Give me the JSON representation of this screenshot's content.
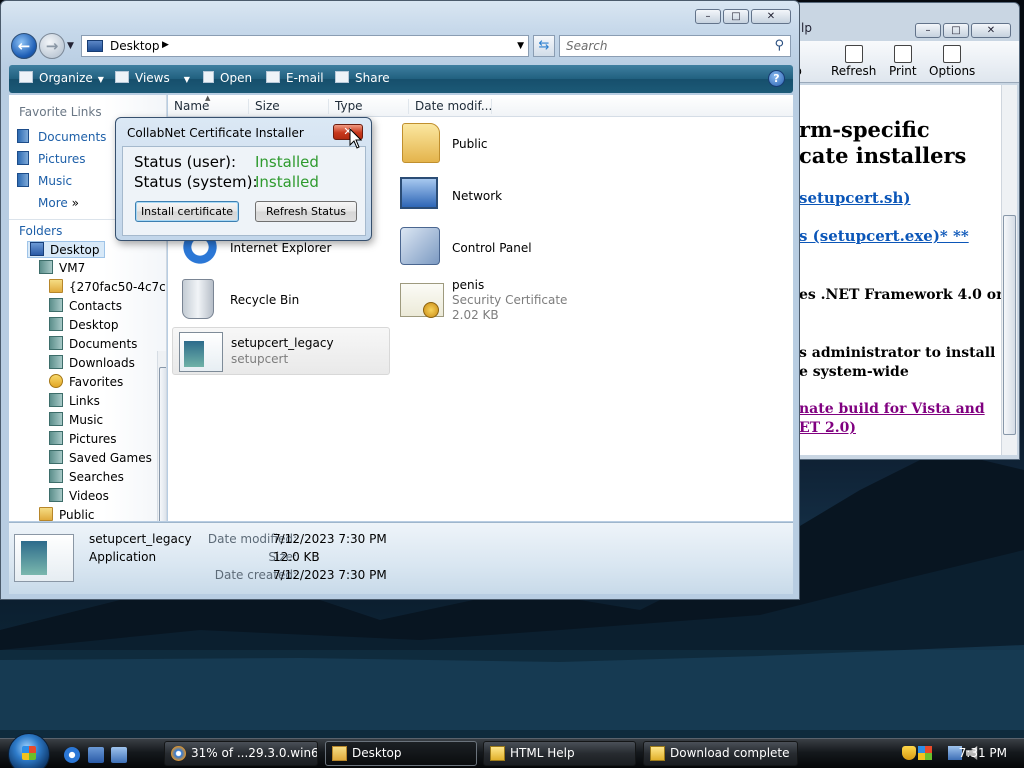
{
  "help_window": {
    "title_fragment": "lp",
    "toolbar": [
      {
        "label": "p",
        "icon": "back-icon"
      },
      {
        "label": "Refresh",
        "icon": "refresh-icon"
      },
      {
        "label": "Print",
        "icon": "print-icon"
      },
      {
        "label": "Options",
        "icon": "options-icon"
      }
    ],
    "content": {
      "heading_line1": "rm-specific",
      "heading_line2": "cate installers",
      "link1": "setupcert.sh)",
      "link2": "s (setupcert.exe)* **",
      "text1": "es .NET Framework 4.0 or",
      "text2": "s administrator to install",
      "text3": "e system-wide",
      "link3_line1": "nate build for Vista and",
      "link3_line2": "ET 2.0)"
    }
  },
  "explorer": {
    "address": "Desktop",
    "search_placeholder": "Search",
    "toolbar": {
      "organize": "Organize",
      "views": "Views",
      "open": "Open",
      "email": "E-mail",
      "share": "Share"
    },
    "nav": {
      "favorite_links_header": "Favorite Links",
      "favorites": [
        "Documents",
        "Pictures",
        "Music",
        "More"
      ],
      "more_arrows": "»",
      "folders_header": "Folders",
      "tree": [
        "Desktop",
        "VM7",
        "{270fac50-4c7c",
        "Contacts",
        "Desktop",
        "Documents",
        "Downloads",
        "Favorites",
        "Links",
        "Music",
        "Pictures",
        "Saved Games",
        "Searches",
        "Videos",
        "Public"
      ]
    },
    "columns": [
      "Name",
      "Size",
      "Type",
      "Date modif..."
    ],
    "items": {
      "public": {
        "name": "Public"
      },
      "network": {
        "name": "Network"
      },
      "ie": {
        "name": "Internet Explorer"
      },
      "control_panel": {
        "name": "Control Panel"
      },
      "recycle_bin": {
        "name": "Recycle Bin"
      },
      "cert": {
        "name": "penis",
        "type": "Security Certificate",
        "size": "2.02 KB"
      },
      "setupcert": {
        "name": "setupcert_legacy",
        "type": "setupcert"
      }
    },
    "details": {
      "name": "setupcert_legacy",
      "type": "Application",
      "modified_label": "Date modified:",
      "modified_value": "7/12/2023 7:30 PM",
      "size_label": "Size:",
      "size_value": "12.0 KB",
      "created_label": "Date created:",
      "created_value": "7/12/2023 7:30 PM"
    }
  },
  "dialog": {
    "title": "CollabNet Certificate Installer",
    "status_user_label": "Status (user):",
    "status_user_value": "Installed",
    "status_system_label": "Status (system):",
    "status_system_value": "Installed",
    "install_button": "Install certificate",
    "refresh_button": "Refresh Status",
    "status_color": "#2e9a2e"
  },
  "taskbar": {
    "tasks": [
      {
        "label": "31% of ...29.3.0.win6...",
        "icon": "firefox-download-icon"
      },
      {
        "label": "Desktop",
        "icon": "folder-icon",
        "active": true
      },
      {
        "label": "HTML Help",
        "icon": "help-icon"
      },
      {
        "label": "Download complete",
        "icon": "help-icon"
      }
    ],
    "clock": "7:31 PM"
  }
}
